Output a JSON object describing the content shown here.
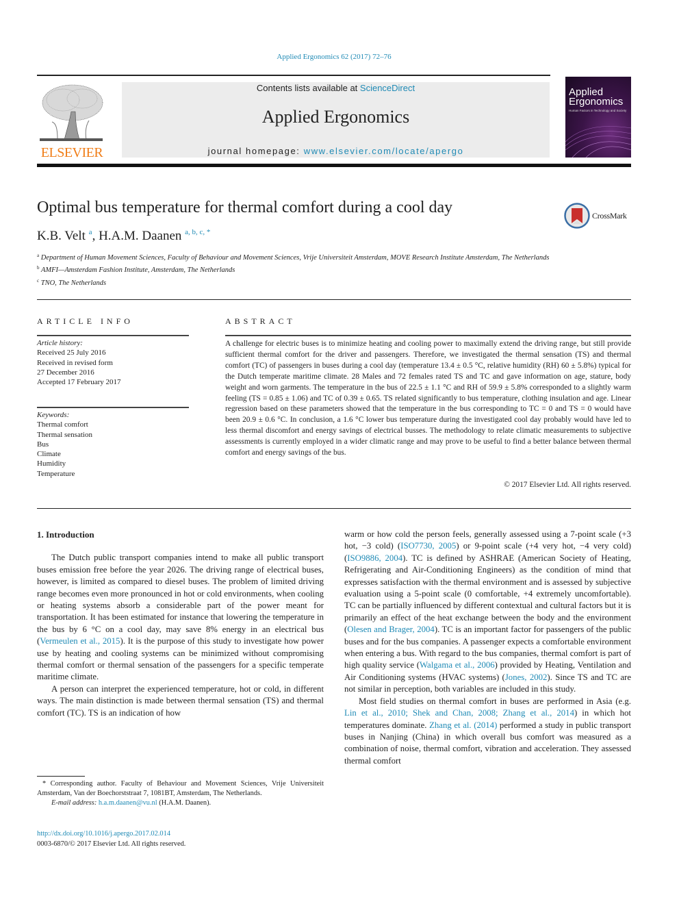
{
  "journal_ref": "Applied Ergonomics 62 (2017) 72–76",
  "masthead": {
    "contents_prefix": "Contents lists available at ",
    "contents_link": "ScienceDirect",
    "journal_title": "Applied Ergonomics",
    "homepage_prefix": "journal homepage: ",
    "homepage_link": "www.elsevier.com/locate/apergo"
  },
  "publisher_logo": {
    "word": "ELSEVIER",
    "color": "#f07d17",
    "icon": "elsevier-tree-icon"
  },
  "cover": {
    "title_line1": "Applied",
    "title_line2": "Ergonomics",
    "subtitle": "Human Factors in Technology and Society",
    "color": "#3a1447"
  },
  "crossmark": {
    "label": "CrossMark",
    "icon": "crossmark-icon"
  },
  "article": {
    "title": "Optimal bus temperature for thermal comfort during a cool day",
    "authors": [
      {
        "name": "K.B. Velt",
        "sup": "a"
      },
      {
        "name": "H.A.M. Daanen",
        "sup": "a, b, c, *"
      }
    ],
    "affiliations": [
      {
        "mark": "a",
        "text": "Department of Human Movement Sciences, Faculty of Behaviour and Movement Sciences, Vrije Universiteit Amsterdam, MOVE Research Institute Amsterdam, The Netherlands"
      },
      {
        "mark": "b",
        "text": "AMFI—Amsterdam Fashion Institute, Amsterdam, The Netherlands"
      },
      {
        "mark": "c",
        "text": "TNO, The Netherlands"
      }
    ]
  },
  "article_info": {
    "heading": "ARTICLE INFO",
    "history_label": "Article history:",
    "history": [
      "Received 25 July 2016",
      "Received in revised form",
      "27 December 2016",
      "Accepted 17 February 2017"
    ],
    "keywords_label": "Keywords:",
    "keywords": [
      "Thermal comfort",
      "Thermal sensation",
      "Bus",
      "Climate",
      "Humidity",
      "Temperature"
    ]
  },
  "abstract": {
    "heading": "ABSTRACT",
    "text": "A challenge for electric buses is to minimize heating and cooling power to maximally extend the driving range, but still provide sufficient thermal comfort for the driver and passengers. Therefore, we investigated the thermal sensation (TS) and thermal comfort (TC) of passengers in buses during a cool day (temperature 13.4 ± 0.5 °C, relative humidity (RH) 60 ± 5.8%) typical for the Dutch temperate maritime climate. 28 Males and 72 females rated TS and TC and gave information on age, stature, body weight and worn garments. The temperature in the bus of 22.5 ± 1.1 °C and RH of 59.9 ± 5.8% corresponded to a slightly warm feeling (TS = 0.85 ± 1.06) and TC of 0.39 ± 0.65. TS related significantly to bus temperature, clothing insulation and age. Linear regression based on these parameters showed that the temperature in the bus corresponding to TC = 0 and TS = 0 would have been 20.9 ± 0.6 °C. In conclusion, a 1.6 °C lower bus temperature during the investigated cool day probably would have led to less thermal discomfort and energy savings of electrical busses. The methodology to relate climatic measurements to subjective assessments is currently employed in a wider climatic range and may prove to be useful to find a better balance between thermal comfort and energy savings of the bus.",
    "copyright": "© 2017 Elsevier Ltd. All rights reserved."
  },
  "body": {
    "section_heading": "1.  Introduction",
    "left_p1": "The Dutch public transport companies intend to make all public transport buses emission free before the year 2026. The driving range of electrical buses, however, is limited as compared to diesel buses. The problem of limited driving range becomes even more pronounced in hot or cold environments, when cooling or heating systems absorb a considerable part of the power meant for transportation. It has been estimated for instance that lowering the temperature in the bus by 6 °C on a cool day, may save 8% energy in an electrical bus (",
    "left_p1_cite": "Vermeulen et al., 2015",
    "left_p1_end": "). It is the purpose of this study to investigate how power use by heating and cooling systems can be minimized without compromising thermal comfort or thermal sensation of the passengers for a specific temperate maritime climate.",
    "left_p2": "A person can interpret the experienced temperature, hot or cold, in different ways. The main distinction is made between thermal sensation (TS) and thermal comfort (TC). TS is an indication of how",
    "right_p1_a": "warm or how cold the person feels, generally assessed using a 7-point scale (+3 hot, −3 cold) (",
    "right_p1_cite1": "ISO7730, 2005",
    "right_p1_b": ") or 9-point scale (+4 very hot, −4 very cold) (",
    "right_p1_cite2": "ISO9886, 2004",
    "right_p1_c": "). TC is defined by ASHRAE (American Society of Heating, Refrigerating and Air-Conditioning Engineers) as the condition of mind that expresses satisfaction with the thermal environment and is assessed by subjective evaluation using a 5-point scale (0 comfortable, +4 extremely uncomfortable). TC can be partially influenced by different contextual and cultural factors but it is primarily an effect of the heat exchange between the body and the environment (",
    "right_p1_cite3": "Olesen and Brager, 2004",
    "right_p1_d": "). TC is an important factor for passengers of the public buses and for the bus companies. A passenger expects a comfortable environment when entering a bus. With regard to the bus companies, thermal comfort is part of high quality service (",
    "right_p1_cite4": "Walgama et al., 2006",
    "right_p1_e": ") provided by Heating, Ventilation and Air Conditioning systems (HVAC systems) (",
    "right_p1_cite5": "Jones, 2002",
    "right_p1_f": "). Since TS and TC are not similar in perception, both variables are included in this study.",
    "right_p2_a": "Most field studies on thermal comfort in buses are performed in Asia (e.g. ",
    "right_p2_cite1": "Lin et al., 2010; Shek and Chan, 2008; Zhang et al., 2014",
    "right_p2_b": ") in which hot temperatures dominate. ",
    "right_p2_cite2": "Zhang et al. (2014)",
    "right_p2_c": " performed a study in public transport buses in Nanjing (China) in which overall bus comfort was measured as a combination of noise, thermal comfort, vibration and acceleration. They assessed thermal comfort"
  },
  "footnote": {
    "corresponding": "* Corresponding author. Faculty of Behaviour and Movement Sciences, Vrije Universiteit Amsterdam, Van der Boechorststraat 7, 1081BT, Amsterdam, The Netherlands.",
    "email_label": "E-mail address: ",
    "email": "h.a.m.daanen@vu.nl",
    "email_suffix": " (H.A.M. Daanen)."
  },
  "doi": {
    "link": "http://dx.doi.org/10.1016/j.apergo.2017.02.014",
    "issn_line": "0003-6870/© 2017 Elsevier Ltd. All rights reserved."
  },
  "colors": {
    "link": "#1f8ab5",
    "elsevier_orange": "#f07d17",
    "masthead_bg": "#ececec"
  }
}
